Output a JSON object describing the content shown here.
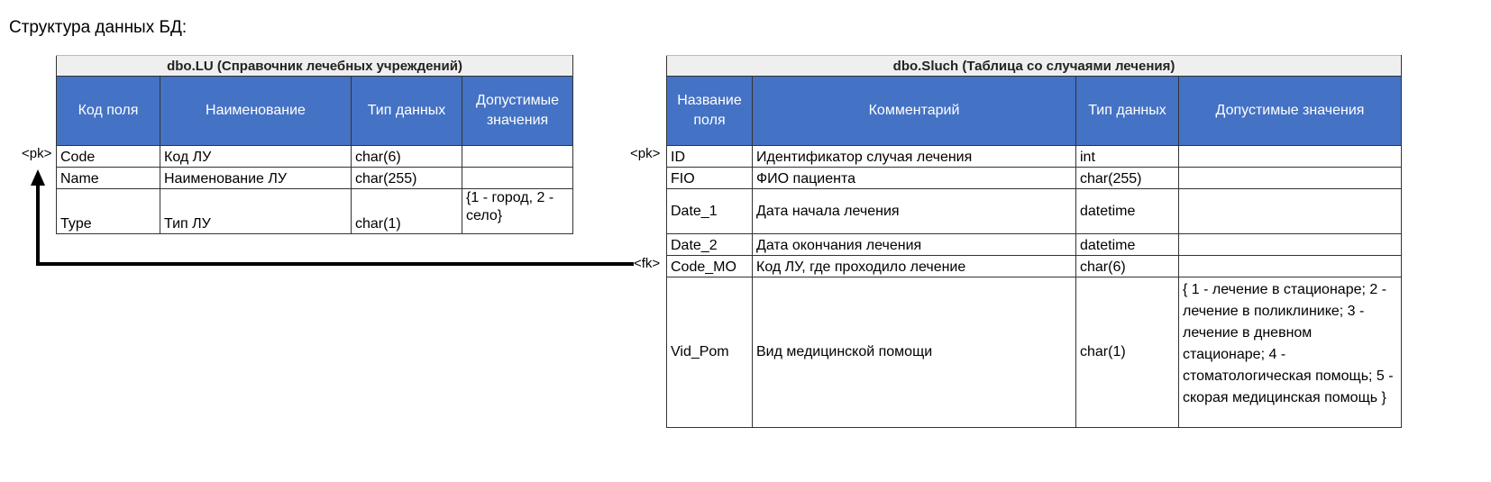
{
  "heading": "Структура данных БД:",
  "markers": {
    "pk": "<pk>",
    "fk": "<fk>"
  },
  "lu": {
    "caption": "dbo.LU (Справочник лечебных учреждений)",
    "headers": [
      "Код поля",
      "Наименование",
      "Тип данных",
      "Допустимые значения"
    ],
    "rows": [
      [
        "Code",
        "Код ЛУ",
        "char(6)",
        ""
      ],
      [
        "Name",
        "Наименование ЛУ",
        "char(255)",
        ""
      ],
      [
        "Type",
        "Тип ЛУ",
        "char(1)",
        "{1 - город, 2 - село}"
      ]
    ]
  },
  "sluch": {
    "caption": "dbo.Sluch (Таблица со случаями лечения)",
    "headers": [
      "Название поля",
      "Комментарий",
      "Тип данных",
      "Допустимые значения"
    ],
    "rows": [
      [
        "ID",
        "Идентификатор случая лечения",
        "int",
        ""
      ],
      [
        "FIO",
        "ФИО пациента",
        "char(255)",
        ""
      ],
      [
        "Date_1",
        "Дата начала лечения",
        "datetime",
        ""
      ],
      [
        "Date_2",
        "Дата окончания лечения",
        "datetime",
        ""
      ],
      [
        "Code_MO",
        "Код ЛУ, где проходило лечение",
        "char(6)",
        ""
      ],
      [
        "Vid_Pom",
        "Вид  медицинской помощи",
        "char(1)",
        "{ 1 - лечение в стационаре; 2 - лечение в поликлинике; 3 - лечение в дневном стационаре; 4 - стоматологическая помощь; 5 - скорая медицинская помощь }"
      ]
    ]
  },
  "colors": {
    "header_bg": "#4472c4",
    "caption_bg": "#efefef",
    "border": "#333333",
    "arrow": "#000000"
  }
}
